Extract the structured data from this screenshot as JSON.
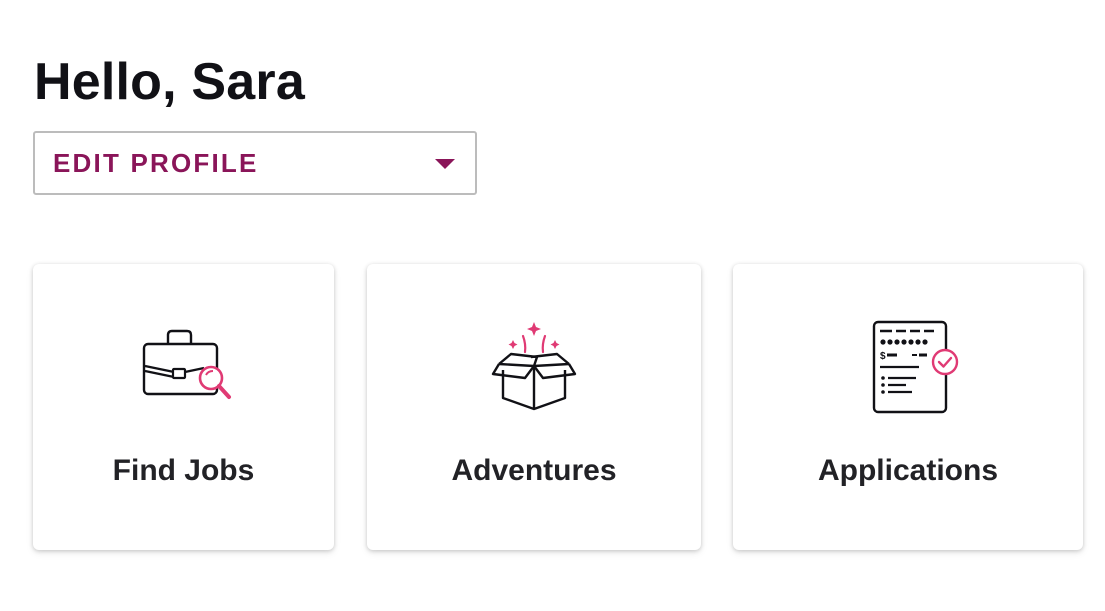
{
  "greeting": "Hello, Sara",
  "profile_menu": {
    "label": "EDIT PROFILE",
    "caret_icon": "caret-down-icon"
  },
  "cards": [
    {
      "label": "Find Jobs",
      "icon": "briefcase-search-icon"
    },
    {
      "label": "Adventures",
      "icon": "open-box-sparkle-icon"
    },
    {
      "label": "Applications",
      "icon": "application-document-check-icon"
    }
  ],
  "colors": {
    "accent": "#8a1559",
    "icon_pink": "#e03a74",
    "text": "#111116",
    "border": "#bcbcbc"
  }
}
